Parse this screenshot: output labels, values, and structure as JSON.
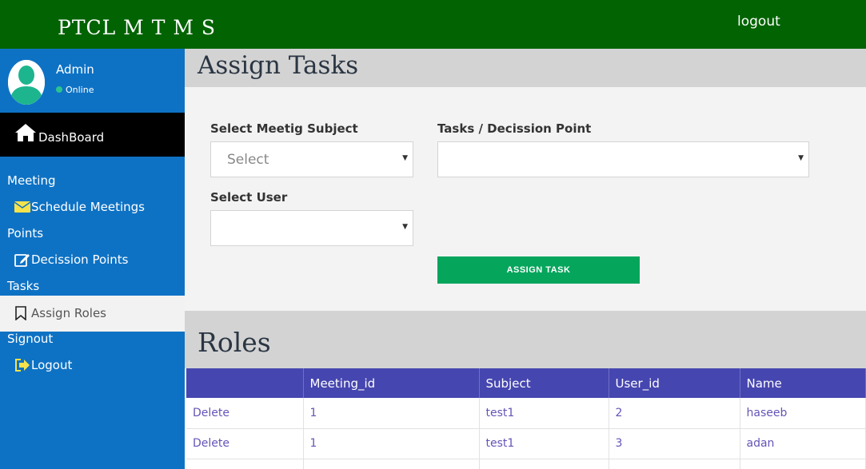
{
  "header": {
    "brand": "PTCL M T M S",
    "logout_link": "logout"
  },
  "sidebar": {
    "user": {
      "name": "Admin",
      "status": "Online"
    },
    "dashboard": "DashBoard",
    "sections": [
      {
        "title": "Meeting",
        "item": "Schedule Meetings",
        "icon": "envelope-icon"
      },
      {
        "title": "Points",
        "item": "Decission Points",
        "icon": "edit-icon"
      },
      {
        "title": "Tasks",
        "item": "Assign Roles",
        "icon": "bookmark-icon"
      },
      {
        "title": "Signout",
        "item": "Logout",
        "icon": "sign-out-icon"
      }
    ],
    "active_item": "Assign Roles"
  },
  "assign_panel": {
    "title": "Assign Tasks",
    "subject_label": "Select Meetig Subject",
    "subject_value": "Select",
    "tasks_label": "Tasks / Decission Point",
    "tasks_value": "",
    "user_label": "Select User",
    "user_value": "",
    "button_label": "ASSIGN TASK"
  },
  "roles": {
    "title": "Roles",
    "columns": [
      "",
      "Meeting_id",
      "Subject",
      "User_id",
      "Name"
    ],
    "rows": [
      {
        "action": "Delete",
        "meeting_id": "1",
        "subject": "test1",
        "user_id": "2",
        "name": "haseeb"
      },
      {
        "action": "Delete",
        "meeting_id": "1",
        "subject": "test1",
        "user_id": "3",
        "name": "adan"
      },
      {
        "action": "",
        "meeting_id": "",
        "subject": "",
        "user_id": "",
        "name": ""
      }
    ]
  },
  "colors": {
    "topbar": "#026302",
    "sidebar": "#0e72c4",
    "table_header": "#4646b0",
    "button": "#05a55c"
  }
}
